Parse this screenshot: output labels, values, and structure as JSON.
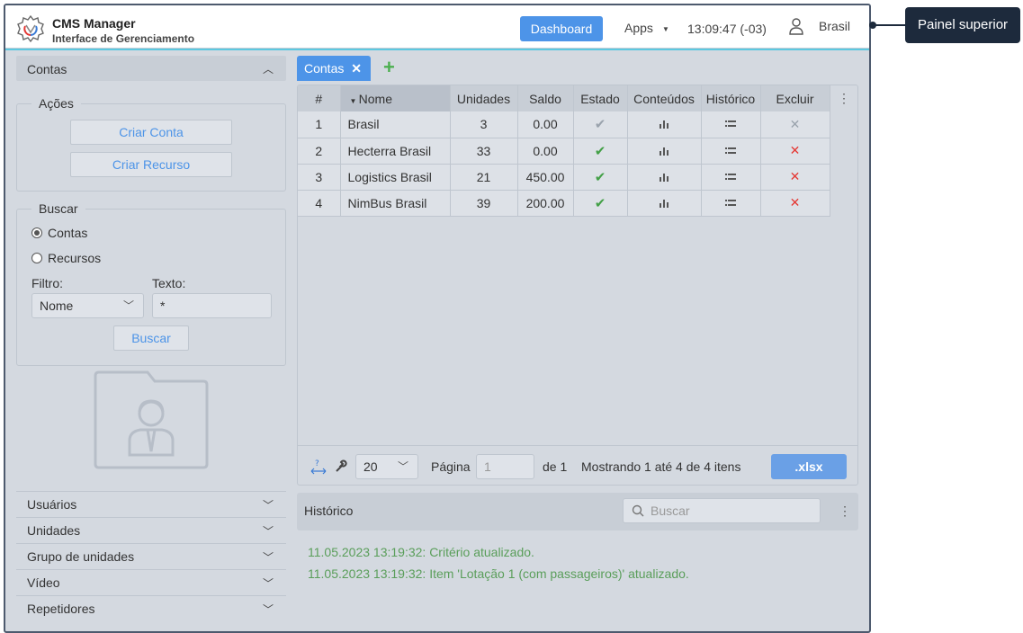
{
  "header": {
    "app_title": "CMS Manager",
    "app_subtitle": "Interface de Gerenciamento",
    "dashboard_label": "Dashboard",
    "apps_label": "Apps",
    "clock": "13:09:47 (-03)",
    "user_name": "Brasil"
  },
  "sidebar": {
    "section_title": "Contas",
    "actions": {
      "legend": "Ações",
      "create_account": "Criar Conta",
      "create_resource": "Criar Recurso"
    },
    "search": {
      "legend": "Buscar",
      "radio_accounts": "Contas",
      "radio_resources": "Recursos",
      "filter_label": "Filtro:",
      "filter_value": "Nome",
      "text_label": "Texto:",
      "text_value": "*",
      "search_button": "Buscar"
    },
    "sections": [
      "Usuários",
      "Unidades",
      "Grupo de unidades",
      "Vídeo",
      "Repetidores"
    ]
  },
  "tabs": {
    "active_label": "Contas"
  },
  "table": {
    "columns": [
      "#",
      "Nome",
      "Unidades",
      "Saldo",
      "Estado",
      "Conteúdos",
      "Histórico",
      "Excluir"
    ],
    "rows": [
      {
        "num": "1",
        "name": "Brasil",
        "units": "3",
        "balance": "0.00",
        "enabled": false
      },
      {
        "num": "2",
        "name": "Hecterra Brasil",
        "units": "33",
        "balance": "0.00",
        "enabled": true
      },
      {
        "num": "3",
        "name": "Logistics Brasil",
        "units": "21",
        "balance": "450.00",
        "enabled": true
      },
      {
        "num": "4",
        "name": "NimBus Brasil",
        "units": "39",
        "balance": "200.00",
        "enabled": true
      }
    ],
    "footer": {
      "page_size": "20",
      "page_label": "Página",
      "page_value": "1",
      "of_label": "de 1",
      "showing": "Mostrando 1 até 4 de 4 itens",
      "export_label": ".xlsx"
    }
  },
  "history": {
    "title": "Histórico",
    "search_placeholder": "Buscar",
    "lines": [
      "11.05.2023 13:19:32: Critério atualizado.",
      "11.05.2023 13:19:32: Item 'Lotação 1 (com passageiros)' atualizado."
    ]
  },
  "annotation": {
    "label": "Painel superior"
  },
  "colors": {
    "accent": "#4d94e8",
    "success": "#43a047",
    "danger": "#e53935",
    "callout": "#1d2a3c"
  }
}
